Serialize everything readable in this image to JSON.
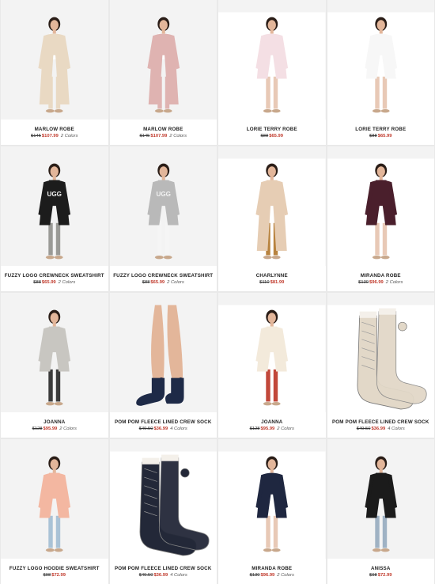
{
  "products": [
    {
      "name": "MARLOW ROBE",
      "was": "$145",
      "now": "$107.99",
      "colors": "2 Colors",
      "icon": "person-beige-long-robe",
      "garment": "#e9d9c3",
      "top": "#ffffff",
      "legs": "#e9d9c3",
      "bg": "#f3f3f3",
      "long": true
    },
    {
      "name": "MARLOW ROBE",
      "was": "$145",
      "now": "$107.99",
      "colors": "2 Colors",
      "icon": "person-pink-long-robe",
      "garment": "#dfb3b1",
      "top": "#ffffff",
      "legs": "#dfb3b1",
      "bg": "#f3f3f3",
      "long": true
    },
    {
      "name": "LORIE TERRY ROBE",
      "was": "$88",
      "now": "$65.99",
      "colors": "",
      "icon": "person-pink-terry-robe",
      "garment": "#f4dfe4",
      "top": "#ffffff",
      "legs": "#e8c9b6",
      "bg": "#ffffff",
      "long": false
    },
    {
      "name": "LORIE TERRY ROBE",
      "was": "$88",
      "now": "$65.99",
      "colors": "",
      "icon": "person-white-terry-robe",
      "garment": "#f7f7f7",
      "top": "#ffffff",
      "legs": "#e8c9b6",
      "bg": "#ffffff",
      "long": false
    },
    {
      "name": "FUZZY LOGO CREWNECK SWEATSHIRT",
      "was": "$88",
      "now": "$65.99",
      "colors": "2 Colors",
      "icon": "person-black-ugg-sweatshirt",
      "garment": "#1c1c1c",
      "top": "#1c1c1c",
      "legs": "#9a9a96",
      "bg": "#f3f3f3",
      "long": false,
      "logo": "UGG"
    },
    {
      "name": "FUZZY LOGO CREWNECK SWEATSHIRT",
      "was": "$88",
      "now": "$65.99",
      "colors": "2 Colors",
      "icon": "person-grey-ugg-sweatshirt",
      "garment": "#b9b9b9",
      "top": "#b9b9b9",
      "legs": "#f5f5f5",
      "bg": "#f3f3f3",
      "long": false,
      "logo": "UGG"
    },
    {
      "name": "CHARLYNNE",
      "was": "$110",
      "now": "$81.99",
      "colors": "",
      "icon": "person-tan-poncho",
      "garment": "#e6cdb4",
      "top": "#e6cdb4",
      "legs": "#b8833f",
      "bg": "#ffffff",
      "long": true
    },
    {
      "name": "MIRANDA ROBE",
      "was": "$130",
      "now": "$96.99",
      "colors": "2 Colors",
      "icon": "person-burgundy-robe",
      "garment": "#4a1f2c",
      "top": "#4a1f2c",
      "legs": "#e8c9b6",
      "bg": "#ffffff",
      "long": false
    },
    {
      "name": "JOANNA",
      "was": "$128",
      "now": "$95.99",
      "colors": "2 Colors",
      "icon": "person-grey-knit-poncho",
      "garment": "#c8c6c1",
      "top": "#c8c6c1",
      "legs": "#3b3b3b",
      "bg": "#f3f3f3",
      "long": false
    },
    {
      "name": "POM POM FLEECE LINED CREW SOCK",
      "was": "$49.50",
      "now": "$36.99",
      "colors": "4 Colors",
      "icon": "legs-navy-socks",
      "garment": "#1e2a47",
      "top": "#efd7c6",
      "legs": "#efd7c6",
      "bg": "#f3f3f3",
      "long": false,
      "socks": true
    },
    {
      "name": "JOANNA",
      "was": "$128",
      "now": "$95.99",
      "colors": "2 Colors",
      "icon": "person-cream-poncho",
      "garment": "#f3eadb",
      "top": "#f3eadb",
      "legs": "#c2483a",
      "bg": "#ffffff",
      "long": false
    },
    {
      "name": "POM POM FLEECE LINED CREW SOCK",
      "was": "$49.50",
      "now": "$36.99",
      "colors": "4 Colors",
      "icon": "cream-knit-socks",
      "garment": "#e2d8c8",
      "top": "#e2d8c8",
      "legs": "#e2d8c8",
      "bg": "#ffffff",
      "long": false,
      "sockpair": true
    },
    {
      "name": "FUZZY LOGO HOODIE SWEATSHIRT",
      "was": "$98",
      "now": "$72.99",
      "colors": "",
      "icon": "person-peach-hoodie",
      "garment": "#f3b7a1",
      "top": "#f3b7a1",
      "legs": "#a9c2d6",
      "bg": "#f3f3f3",
      "long": false
    },
    {
      "name": "POM POM FLEECE LINED CREW SOCK",
      "was": "$49.50",
      "now": "$36.99",
      "colors": "4 Colors",
      "icon": "navy-knit-socks",
      "garment": "#232838",
      "top": "#232838",
      "legs": "#232838",
      "bg": "#ffffff",
      "long": false,
      "sockpair": true
    },
    {
      "name": "MIRANDA ROBE",
      "was": "$130",
      "now": "$96.99",
      "colors": "2 Colors",
      "icon": "person-navy-robe",
      "garment": "#1f2740",
      "top": "#ffffff",
      "legs": "#e8c9b6",
      "bg": "#ffffff",
      "long": false
    },
    {
      "name": "ANISSA",
      "was": "$98",
      "now": "$72.99",
      "colors": "",
      "icon": "person-black-poncho",
      "garment": "#1b1b1b",
      "top": "#1b1b1b",
      "legs": "#9fb2c4",
      "bg": "#f3f3f3",
      "long": false
    }
  ]
}
